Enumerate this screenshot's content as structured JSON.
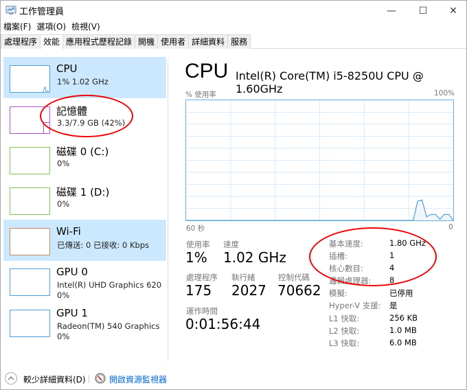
{
  "window": {
    "title": "工作管理員",
    "icon": "task-manager-icon",
    "controls": {
      "minimize": "—",
      "maximize": "☐",
      "close": "✕"
    }
  },
  "menu": [
    "檔案(F)",
    "選項(O)",
    "檢視(V)"
  ],
  "tabs": [
    {
      "label": "處理程序",
      "active": false
    },
    {
      "label": "效能",
      "active": true
    },
    {
      "label": "應用程式歷程記錄",
      "active": false
    },
    {
      "label": "開機",
      "active": false
    },
    {
      "label": "使用者",
      "active": false
    },
    {
      "label": "詳細資料",
      "active": false
    },
    {
      "label": "服務",
      "active": false
    }
  ],
  "sidebar": {
    "items": [
      {
        "title": "CPU",
        "line1": "1% 1.02 GHz",
        "line2": "",
        "color": "#4c9fd4",
        "selected": true
      },
      {
        "title": "記憶體",
        "line1": "3.3/7.9 GB (42%)",
        "line2": "",
        "color": "#b04fd0",
        "selected": false
      },
      {
        "title": "磁碟 0 (C:)",
        "line1": "0%",
        "line2": "",
        "color": "#7cc450",
        "selected": false
      },
      {
        "title": "磁碟 1 (D:)",
        "line1": "0%",
        "line2": "",
        "color": "#7cc450",
        "selected": false
      },
      {
        "title": "Wi-Fi",
        "line1": "已傳送: 0 已接收: 0 Kbps",
        "line2": "",
        "color": "#c7895c",
        "selected": false,
        "highlight": true
      },
      {
        "title": "GPU 0",
        "line1": "Intel(R) UHD Graphics 620",
        "line2": "0%",
        "color": "#4c9fd4",
        "selected": false
      },
      {
        "title": "GPU 1",
        "line1": "Radeon(TM) 540 Graphics",
        "line2": "0%",
        "color": "#4c9fd4",
        "selected": false
      }
    ]
  },
  "main": {
    "title": "CPU",
    "model": "Intel(R) Core(TM) i5-8250U CPU @ 1.60GHz",
    "graph": {
      "ylabel": "% 使用率",
      "ymax_label": "100%",
      "xmin_label": "60 秒",
      "xmax_label": "0",
      "line_color": "#4c9fd4",
      "usage_percent_history": [
        0,
        0,
        0,
        0,
        0,
        0,
        0,
        0,
        0,
        0,
        0,
        0,
        0,
        0,
        0,
        0,
        0,
        0,
        0,
        0,
        0,
        0,
        0,
        0,
        0,
        0,
        0,
        0,
        0,
        0,
        0,
        0,
        0,
        0,
        0,
        0,
        0,
        0,
        0,
        0,
        0,
        0,
        0,
        0,
        0,
        0,
        0,
        0,
        0,
        0,
        0,
        0,
        16,
        17,
        3,
        5,
        5,
        1,
        5,
        5,
        0
      ]
    },
    "stats": {
      "utilization": {
        "label": "使用率",
        "value": "1%"
      },
      "speed": {
        "label": "速度",
        "value": "1.02 GHz"
      },
      "processes": {
        "label": "處理程序",
        "value": "175"
      },
      "threads": {
        "label": "執行緒",
        "value": "2027"
      },
      "handles": {
        "label": "控制代碼",
        "value": "70662"
      },
      "uptime": {
        "label": "運作時間",
        "value": "0:01:56:44"
      }
    },
    "details": [
      {
        "label": "基本速度:",
        "value": "1.80 GHz"
      },
      {
        "label": "插槽:",
        "value": "1"
      },
      {
        "label": "核心數目:",
        "value": "4"
      },
      {
        "label": "邏輯處理器:",
        "value": "8"
      },
      {
        "label": "模擬:",
        "value": "已停用"
      },
      {
        "label": "Hyper-V 支援:",
        "value": "是"
      },
      {
        "label": "L1 快取:",
        "value": "256 KB"
      },
      {
        "label": "L2 快取:",
        "value": "1.0 MB"
      },
      {
        "label": "L3 快取:",
        "value": "6.0 MB"
      }
    ]
  },
  "footer": {
    "fewer_details": "較少詳細資料(D)",
    "open_resource_monitor": "開啟資源監視器"
  },
  "annotation_color": "#e00000"
}
